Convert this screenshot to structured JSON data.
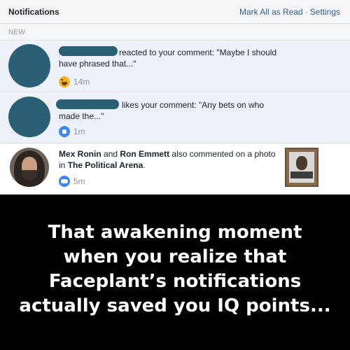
{
  "header": {
    "title": "Notifications",
    "mark_all_read": "Mark All as Read",
    "separator": "·",
    "settings": "Settings"
  },
  "section": {
    "label": "NEW"
  },
  "notifications": [
    {
      "state": "unread",
      "actor": "",
      "text": "reacted to your comment: \"Maybe I should have phrased that...\"",
      "reaction_icon": "haha-reaction-icon",
      "time": "14m"
    },
    {
      "state": "unread",
      "actor": "",
      "text": "likes your comment: \"Any bets on who made the...\"",
      "reaction_icon": "like-reaction-icon",
      "time": "1m"
    },
    {
      "state": "read",
      "actor_1": "Mex Ronin",
      "connector_1": "and",
      "actor_2": "Ron Emmett",
      "text_1": "also commented on a photo in",
      "group": "The Political Arena",
      "text_2": ".",
      "reaction_icon": "comment-group-icon",
      "time": "5m"
    }
  ],
  "caption": {
    "line_1": "That awakening moment",
    "line_2": "when you realize that",
    "line_3": "Faceplant’s notifications",
    "line_4": "actually saved you IQ points..."
  },
  "colors": {
    "header_bg": "#f5f6f7",
    "unread_bg": "#edf2fa",
    "link": "#365899",
    "redaction": "#2a5f75",
    "caption_bg": "#000000"
  }
}
